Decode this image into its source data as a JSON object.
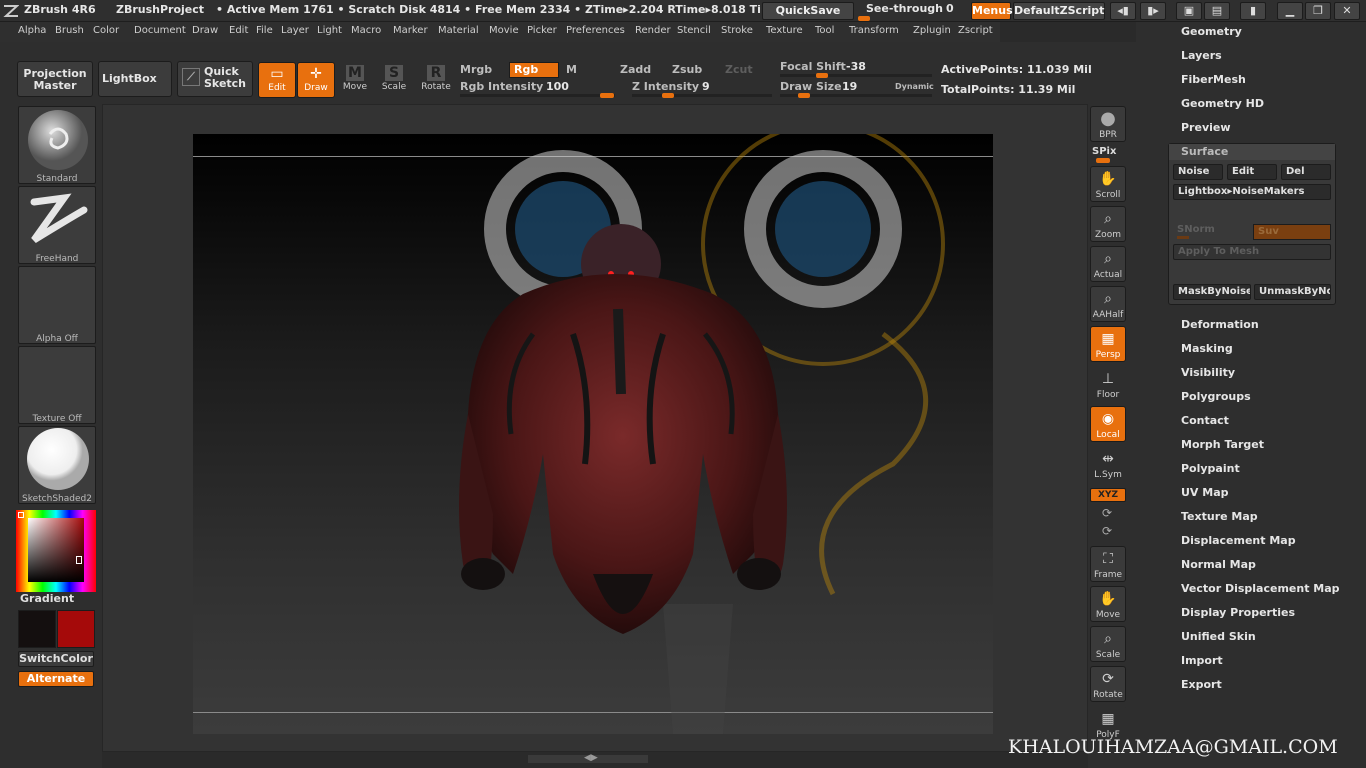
{
  "titlebar": {
    "app": "ZBrush 4R6",
    "project": "ZBrushProject",
    "stats": "• Active Mem 1761 • Scratch Disk 4814 • Free Mem 2334 • ZTime▸2.204 RTime▸8.018 Ti",
    "quicksave": "QuickSave",
    "seethrough": "See-through",
    "seethrough_value": "0",
    "menus": "Menus",
    "default_zscript": "DefaultZScript"
  },
  "menubar": [
    "Alpha",
    "Brush",
    "Color",
    "Document",
    "Draw",
    "Edit",
    "File",
    "Layer",
    "Light",
    "Macro",
    "Marker",
    "Material",
    "Movie",
    "Picker",
    "Preferences",
    "Render",
    "Stencil",
    "Stroke",
    "Texture",
    "Tool",
    "Transform",
    "Zplugin",
    "Zscript"
  ],
  "shelf": {
    "projection_master": "Projection Master",
    "lightbox": "LightBox",
    "quick_sketch": "Quick Sketch",
    "tools": [
      {
        "label": "Edit",
        "glyph": "▭"
      },
      {
        "label": "Draw",
        "glyph": "✛"
      },
      {
        "label": "Move",
        "glyph": "M"
      },
      {
        "label": "Scale",
        "glyph": "S"
      },
      {
        "label": "Rotate",
        "glyph": "R"
      }
    ],
    "mrgb": "Mrgb",
    "rgb": "Rgb",
    "m": "M",
    "zadd": "Zadd",
    "zsub": "Zsub",
    "zcut": "Zcut",
    "rgb_intensity_label": "Rgb Intensity",
    "rgb_intensity_value": "100",
    "z_intensity_label": "Z Intensity",
    "z_intensity_value": "9",
    "focal_shift_label": "Focal Shift",
    "focal_shift_value": "-38",
    "draw_size_label": "Draw Size",
    "draw_size_value": "19",
    "dynamic": "Dynamic",
    "active_points": "ActivePoints: 11.039 Mil",
    "total_points": "TotalPoints: 11.39 Mil"
  },
  "lefttray": {
    "brush": "Standard",
    "stroke": "FreeHand",
    "alpha": "Alpha Off",
    "texture": "Texture Off",
    "material": "SketchShaded2",
    "gradient": "Gradient",
    "switchcolor": "SwitchColor",
    "alternate": "Alternate",
    "main_color": "#140f0f",
    "secondary_color": "#a50a0a"
  },
  "righttray": [
    {
      "label": "BPR",
      "glyph": "●",
      "active": false
    },
    {
      "label": "Scroll",
      "glyph": "✋",
      "active": false
    },
    {
      "label": "Zoom",
      "glyph": "⌕",
      "active": false
    },
    {
      "label": "Actual",
      "glyph": "⌕",
      "active": false
    },
    {
      "label": "AAHalf",
      "glyph": "⌕",
      "active": false
    },
    {
      "label": "Persp",
      "glyph": "▦",
      "active": true
    },
    {
      "label": "Floor",
      "glyph": "⊥",
      "active": false
    },
    {
      "label": "Local",
      "glyph": "◉",
      "active": true
    },
    {
      "label": "L.Sym",
      "glyph": "⇹",
      "active": false
    },
    {
      "label": "Frame",
      "glyph": "⛶",
      "active": false
    },
    {
      "label": "Move",
      "glyph": "✋",
      "active": false
    },
    {
      "label": "Scale",
      "glyph": "⌕",
      "active": false
    },
    {
      "label": "Rotate",
      "glyph": "⟳",
      "active": false
    },
    {
      "label": "PolyF",
      "glyph": "▦",
      "active": false
    }
  ],
  "righttray_extra": {
    "spix": "SPix",
    "xyz": "XYZ"
  },
  "palette": {
    "top": [
      "Geometry",
      "Layers",
      "FiberMesh",
      "Geometry HD",
      "Preview"
    ],
    "surface": {
      "title": "Surface",
      "noise": "Noise",
      "edit": "Edit",
      "del": "Del",
      "lightbox": "Lightbox▸NoiseMakers",
      "snorm": "SNorm",
      "suv": "Suv",
      "apply": "Apply To Mesh",
      "mask": "MaskByNoise",
      "unmask": "UnmaskByNo"
    },
    "bottom": [
      "Deformation",
      "Masking",
      "Visibility",
      "Polygroups",
      "Contact",
      "Morph Target",
      "Polypaint",
      "UV Map",
      "Texture Map",
      "Displacement Map",
      "Normal Map",
      "Vector Displacement Map",
      "Display Properties",
      "Unified Skin",
      "Import",
      "Export"
    ]
  },
  "watermark": "KHALOUIHAMZAA@GMAIL.COM"
}
